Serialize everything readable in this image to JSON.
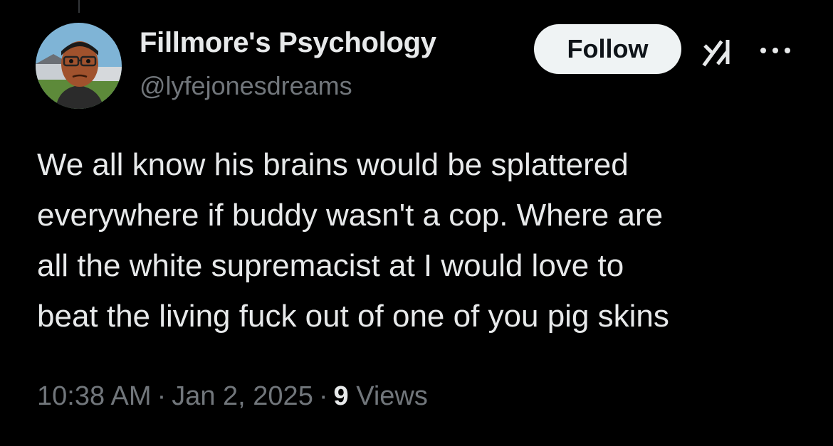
{
  "tweet": {
    "author": {
      "display_name": "Fillmore's Psychology",
      "handle": "@lyfejonesdreams",
      "avatar_icon": "cartoon-character-avatar"
    },
    "follow_label": "Follow",
    "grok_icon": "grok-icon",
    "more_icon": "more-dots-icon",
    "text_lines": [
      "We all know his brains would be splattered",
      "everywhere if buddy wasn't a cop. Where are",
      "all the white supremacist at I would love to",
      "beat the living fuck out of one of you pig skins"
    ],
    "time": "10:38 AM",
    "date": "Jan 2, 2025",
    "separator": "·",
    "views_count": "9",
    "views_label": "Views"
  },
  "colors": {
    "background": "#000000",
    "primary_text": "#e7e9ea",
    "secondary_text": "#71767b",
    "follow_button_bg": "#eff3f4",
    "follow_button_text": "#0f1419"
  }
}
